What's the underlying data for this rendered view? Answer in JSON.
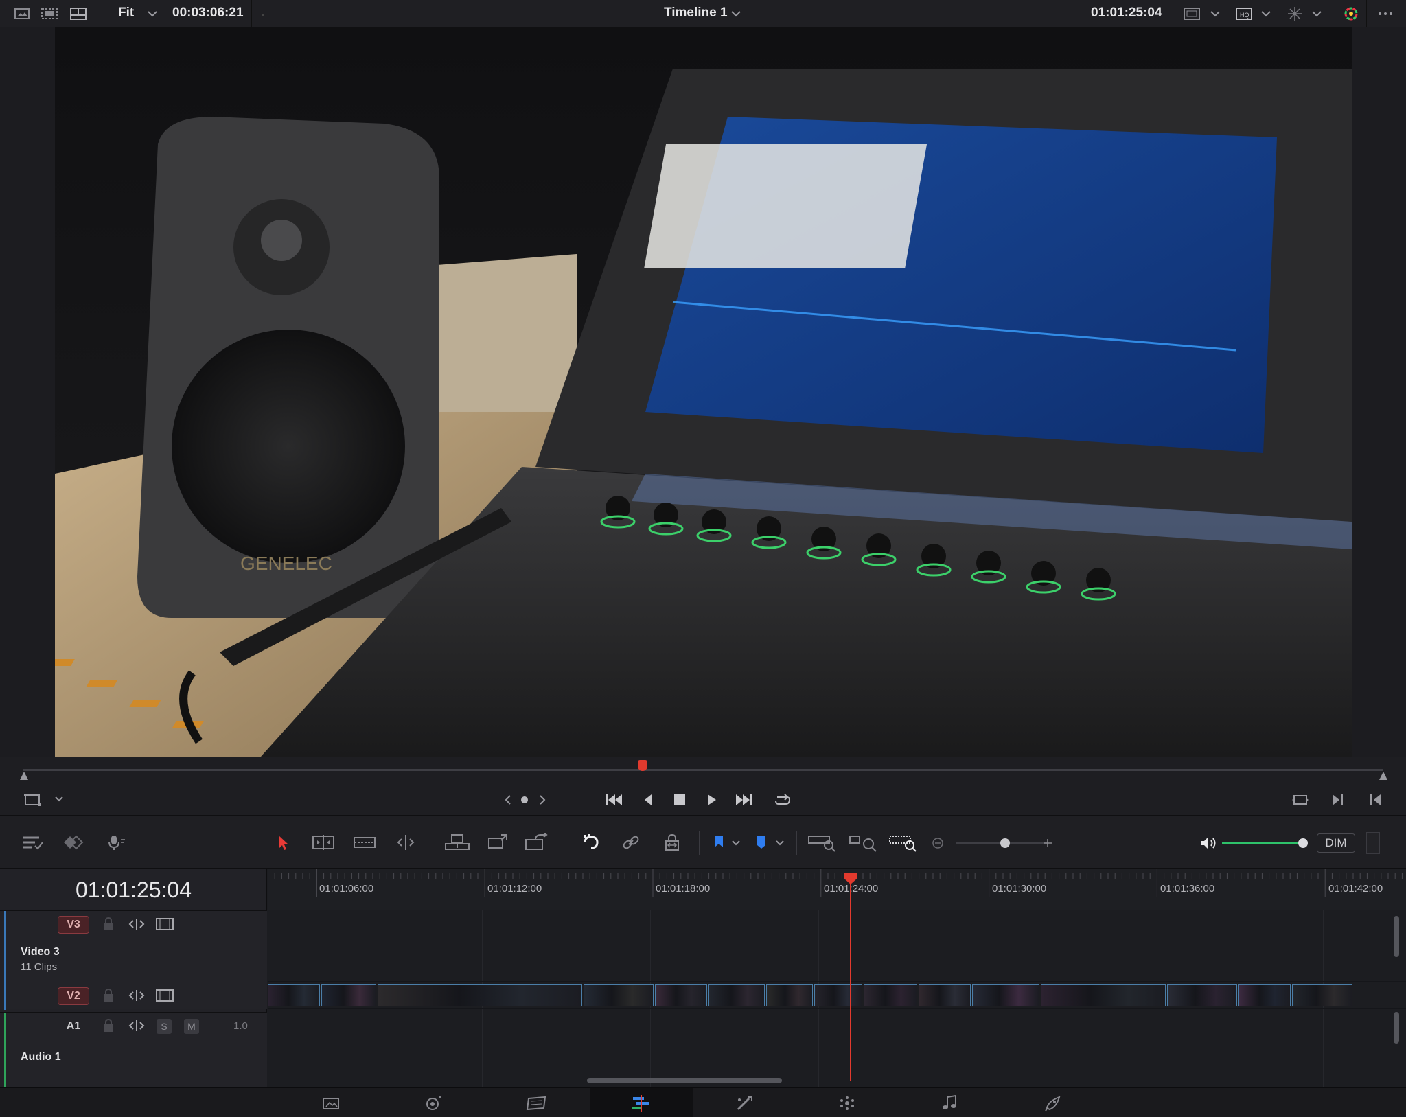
{
  "topbar": {
    "zoom_label": "Fit",
    "source_timecode": "00:03:06:21",
    "timeline_name": "Timeline 1",
    "record_timecode": "01:01:25:04",
    "icons": [
      "single-viewer-icon",
      "cinema-viewer-icon",
      "dual-viewer-icon",
      "chevron-down-icon",
      "safe-area-icon",
      "proxy-icon",
      "fx-overlay-icon",
      "color-wheel-icon",
      "more-options-icon"
    ]
  },
  "viewer": {
    "frame_description_label": "GENELEC"
  },
  "scrubber": {
    "playhead_fraction": 0.452
  },
  "transport": {
    "buttons": [
      "go-to-start",
      "step-back",
      "stop",
      "play",
      "go-to-end",
      "loop"
    ],
    "icons": [
      "transform-icon",
      "prev-edit-icon",
      "jog-dot-icon",
      "next-edit-icon",
      "match-frame-icon",
      "in-out-forward-icon",
      "in-out-backward-icon"
    ]
  },
  "toolbar": {
    "tools": [
      "timeline-view-options",
      "snapping-toggle",
      "voiceover-mic",
      "selection-mode",
      "trim-edit-mode",
      "dynamic-trim-mode",
      "blade-edit-mode",
      "insert-clip",
      "overwrite-clip",
      "replace-clip",
      "snap",
      "linked-selection",
      "position-lock",
      "flag",
      "marker",
      "zoom-full",
      "zoom-detail",
      "zoom-custom"
    ],
    "zoom_level": 0.6,
    "volume_level": 1.0,
    "dim_label": "DIM"
  },
  "timeline": {
    "timecode": "01:01:25:04",
    "ruler_labels": [
      "01:01:06:00",
      "01:01:12:00",
      "01:01:18:00",
      "01:01:24:00",
      "01:01:30:00",
      "01:01:36:00",
      "01:01:42:00"
    ],
    "tracks": {
      "v3": {
        "tag": "V3",
        "name": "Video 3",
        "clips": "11 Clips"
      },
      "v2": {
        "tag": "V2"
      },
      "a1": {
        "tag": "A1",
        "name": "Audio 1",
        "level": "1.0",
        "solo": "S",
        "mute": "M"
      }
    }
  },
  "pagebar": {
    "pages": [
      "media",
      "cut",
      "edit",
      "fusion",
      "color",
      "fairlight",
      "deliver"
    ],
    "active_page": "edit"
  }
}
